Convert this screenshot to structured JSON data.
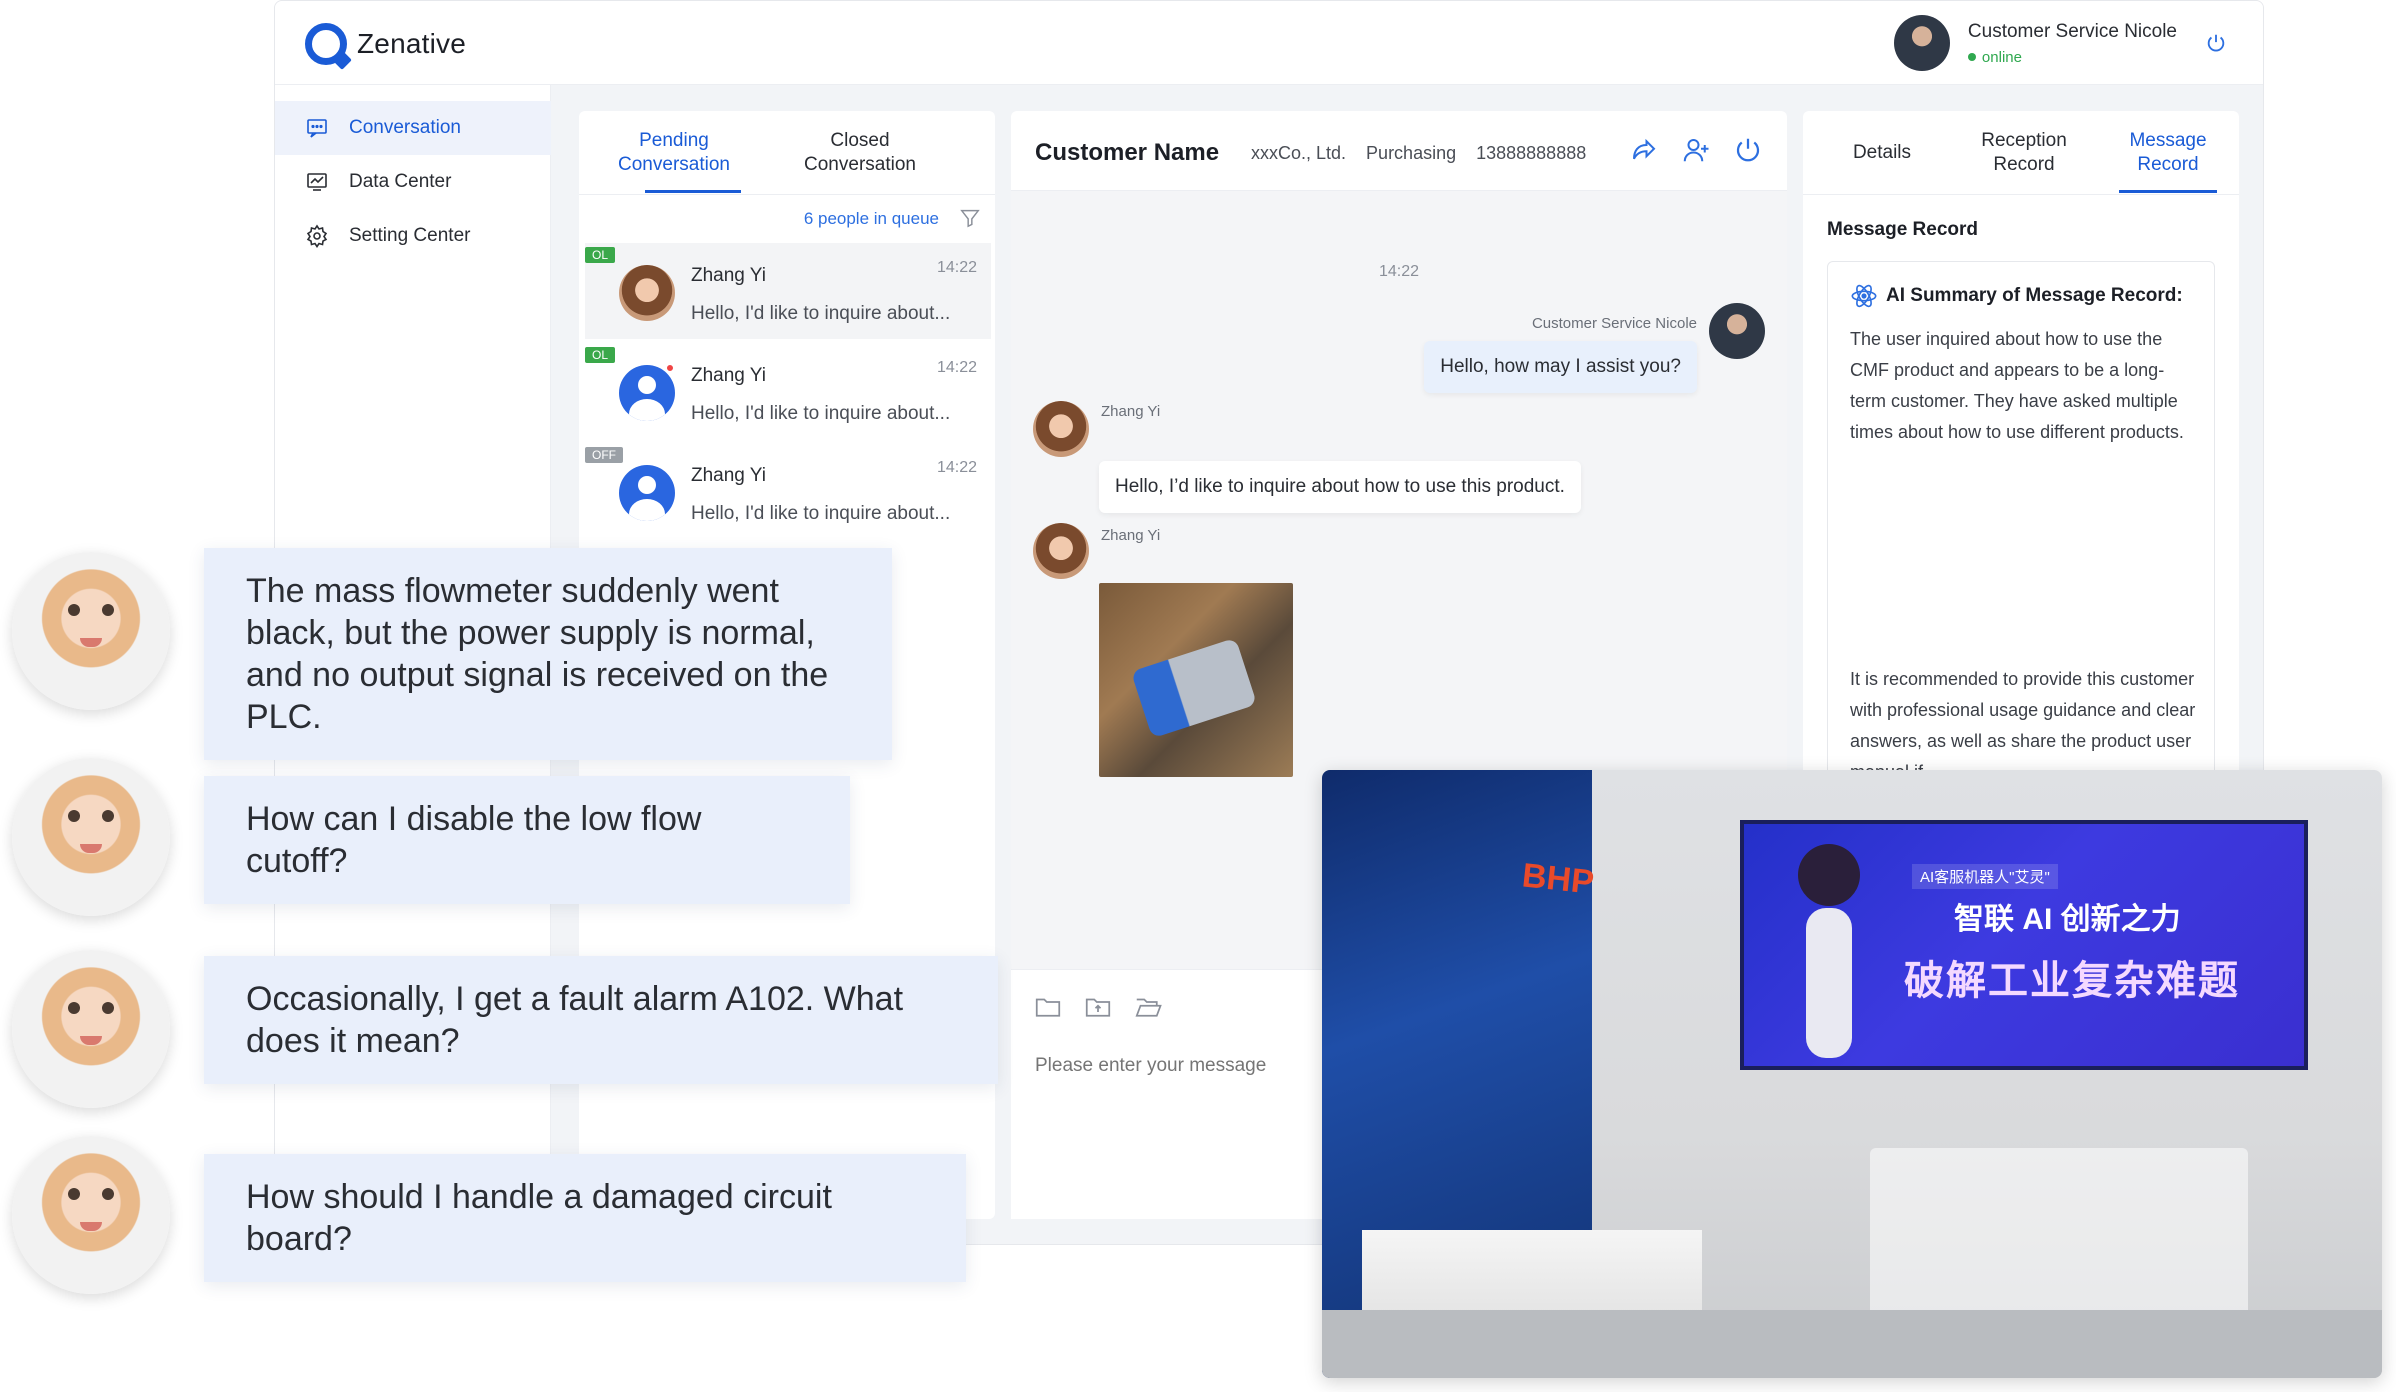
{
  "app": {
    "brand": "Zenative"
  },
  "agent": {
    "name": "Customer Service Nicole",
    "status": "online"
  },
  "sidebar": {
    "items": [
      {
        "label": "Conversation",
        "icon": "chat-icon",
        "active": true
      },
      {
        "label": "Data Center",
        "icon": "monitor-chart-icon",
        "active": false
      },
      {
        "label": "Setting Center",
        "icon": "gear-icon",
        "active": false
      }
    ]
  },
  "queue": {
    "tabs": [
      {
        "label": "Pending\nConversation",
        "active": true
      },
      {
        "label": "Closed\nConversation",
        "active": false
      }
    ],
    "count": "6 people in queue",
    "items": [
      {
        "badge": "OL",
        "name": "Zhang Yi",
        "time": "14:22",
        "preview": "Hello, I'd like to inquire about...",
        "selected": true
      },
      {
        "badge": "OL",
        "name": "Zhang Yi",
        "time": "14:22",
        "preview": "Hello, I'd like to inquire about...",
        "selected": false
      },
      {
        "badge": "OFF",
        "name": "Zhang Yi",
        "time": "14:22",
        "preview": "Hello, I'd like to inquire about...",
        "selected": false
      }
    ]
  },
  "chat": {
    "customer": {
      "name": "Customer Name",
      "company": "xxxCo., Ltd.",
      "dept": "Purchasing",
      "phone": "13888888888"
    },
    "timestamp": "14:22",
    "messages": [
      {
        "sender": "Customer Service Nicole",
        "text": "Hello, how may I assist you?"
      },
      {
        "sender": "Zhang Yi",
        "text": "Hello, I’d like to inquire about how to use this product."
      },
      {
        "sender": "Zhang Yi",
        "text": ""
      }
    ],
    "input_placeholder": "Please enter your message"
  },
  "details": {
    "tabs": [
      {
        "label": "Details",
        "active": false
      },
      {
        "label": "Reception\nRecord",
        "active": false
      },
      {
        "label": "Message\nRecord",
        "active": true
      }
    ],
    "section_title": "Message Record",
    "summary_title": "AI Summary of Message Record:",
    "summary_text": "The user inquired about how to use the CMF product and appears to be a long-term customer. They have asked multiple times about how to use different products.",
    "recommendation": "It is recommended to provide this customer with professional usage guidance and clear answers, as well as share the product user manual if"
  },
  "questions": [
    "The mass flowmeter suddenly went black, but the power supply is normal, and no output signal is received on the PLC.",
    "How can I disable the low flow cutoff?",
    "Occasionally, I get a fault alarm A102. What does it mean?",
    "How should I handle a damaged circuit board?"
  ],
  "expo": {
    "screen_small": "AI客服机器人\"艾灵\"",
    "screen_line1": "智联 AI  创新之力",
    "screen_line2": "破解工业复杂难题",
    "booth_sign": "BHP"
  },
  "colors": {
    "brand": "#1a5bd6",
    "online": "#2fa84f",
    "bubble": "#e9effb"
  }
}
